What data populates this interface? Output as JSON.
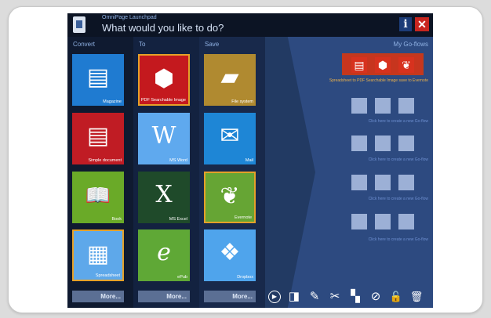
{
  "window": {
    "app_name": "OmniPage Launchpad",
    "question": "What would you like to do?",
    "info_label": "i",
    "close_label": "✕"
  },
  "columns": {
    "convert": {
      "header": "Convert",
      "tiles": [
        {
          "label": "Magazine",
          "icon": "magazine-icon",
          "color": "#1f7bd1"
        },
        {
          "label": "Simple document",
          "icon": "document-icon",
          "color": "#c01c24"
        },
        {
          "label": "Book",
          "icon": "book-icon",
          "color": "#6aaa28"
        },
        {
          "label": "Spreadsheet",
          "icon": "spreadsheet-icon",
          "color": "#5ea8ea",
          "selected": true
        }
      ],
      "more_label": "More..."
    },
    "to": {
      "header": "To",
      "tiles": [
        {
          "label": "PDF Searchable Image",
          "icon": "pdf-icon",
          "color": "#c4191e",
          "selected": true
        },
        {
          "label": "MS Word",
          "icon": "word-icon",
          "color": "#5fa9ee"
        },
        {
          "label": "MS Excel",
          "icon": "excel-icon",
          "color": "#1f4a2a"
        },
        {
          "label": "ePub",
          "icon": "epub-icon",
          "color": "#5fa836"
        }
      ],
      "more_label": "More..."
    },
    "save": {
      "header": "Save",
      "tiles": [
        {
          "label": "File system",
          "icon": "folder-icon",
          "color": "#b08a30"
        },
        {
          "label": "Mail",
          "icon": "mail-icon",
          "color": "#1e86d6"
        },
        {
          "label": "Evernote",
          "icon": "evernote-icon",
          "color": "#66a534",
          "selected": true
        },
        {
          "label": "Dropbox",
          "icon": "dropbox-icon",
          "color": "#4fa4ec"
        }
      ],
      "more_label": "More..."
    }
  },
  "goflows": {
    "title": "My Go-flows",
    "active": {
      "caption": "Spreadsheet to PDF Searchable Image save to Evernote"
    },
    "empty": [
      {
        "caption": "Click here to create a new Go-flow"
      },
      {
        "caption": "Click here to create a new Go-flow"
      },
      {
        "caption": "Click here to create a new Go-flow"
      },
      {
        "caption": "Click here to create a new Go-flow"
      }
    ]
  },
  "toolbar": [
    "play-icon",
    "new-flow-icon",
    "edit-icon",
    "tools-icon",
    "paint-icon",
    "unlink-icon",
    "lock-icon",
    "delete-icon"
  ],
  "glyphs": {
    "magazine": "▤",
    "document": "▤",
    "book": "📖",
    "spreadsheet": "▦",
    "pdf": "⬢",
    "word": "W",
    "excel": "X",
    "epub": "e",
    "folder": "▰",
    "mail": "✉",
    "evernote": "❦",
    "dropbox": "❖",
    "play": "▶",
    "new": "◨",
    "edit": "✎",
    "tools": "✂",
    "paint": "▚",
    "unlink": "⊘",
    "lock": "🔓",
    "trash": "🗑"
  },
  "colors": {
    "background": "#1b2a47",
    "selection_border": "#e5a129",
    "goflow_active": "#c7351e",
    "goflow_empty": "#9cb0d6"
  }
}
